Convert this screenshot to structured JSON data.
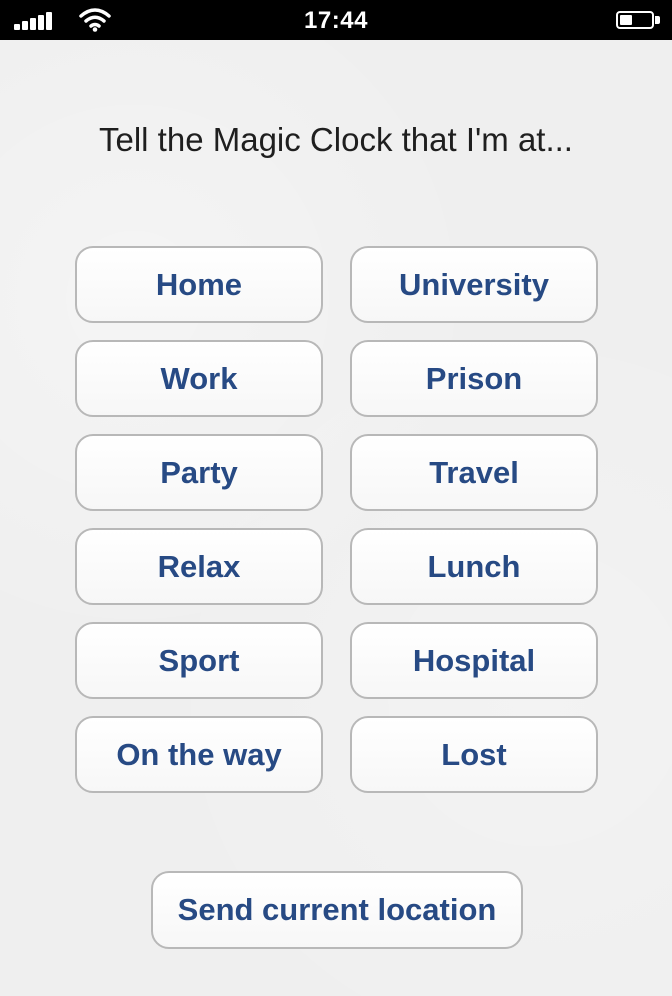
{
  "status_bar": {
    "time": "17:44"
  },
  "prompt": "Tell the Magic Clock that I'm at...",
  "locations": [
    "Home",
    "University",
    "Work",
    "Prison",
    "Party",
    "Travel",
    "Relax",
    "Lunch",
    "Sport",
    "Hospital",
    "On the way",
    "Lost"
  ],
  "send_location_label": "Send current location",
  "icons": {
    "signal": "signal-strength-icon",
    "wifi": "wifi-icon",
    "battery": "battery-icon"
  },
  "colors": {
    "button_text": "#274a84",
    "background": "#efefef",
    "status_bar": "#000000"
  }
}
